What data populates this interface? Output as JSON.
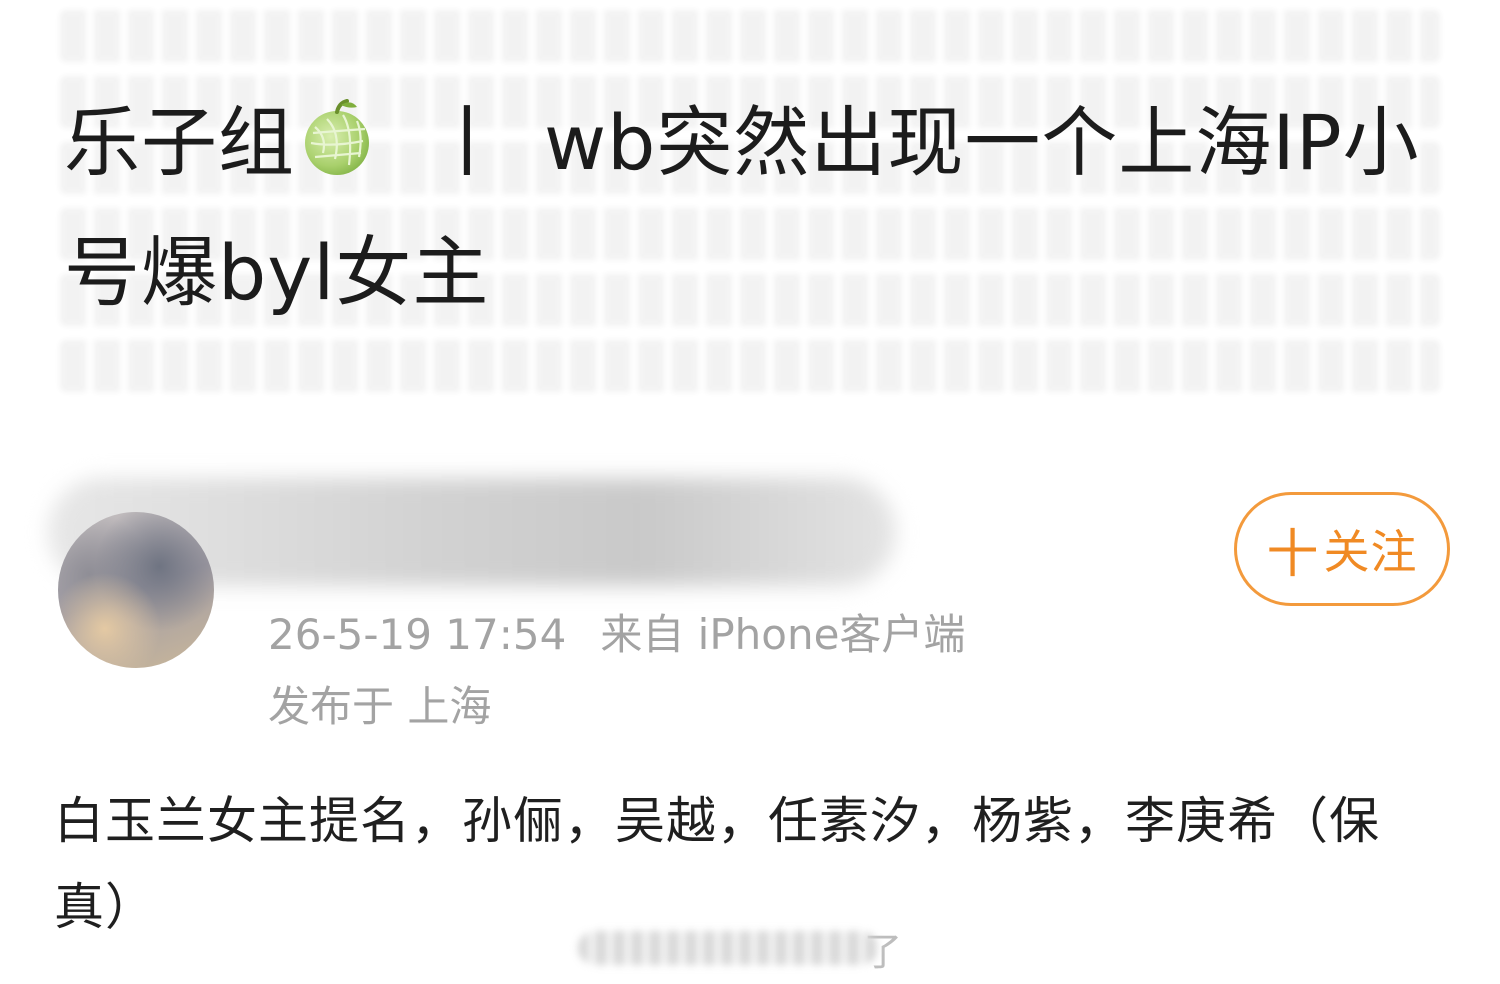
{
  "post": {
    "title_part1": "乐子组",
    "title_icon": "melon-icon",
    "title_separator": "丨",
    "title_part2": "wb突然出现一个上海IP小号爆byl女主",
    "follow_label": "关注",
    "follow_plus": "十",
    "timestamp": "26-5-19 17:54",
    "source": "来自 iPhone客户端",
    "location": "发布于 上海",
    "body": "白玉兰女主提名，孙俪，吴越，任素汐，杨紫，李庚希（保真）",
    "watermark_suffix": "了"
  },
  "colors": {
    "accent": "#f08a24",
    "meta_text": "#a3a3a3",
    "body_text": "#1f1f1f"
  }
}
